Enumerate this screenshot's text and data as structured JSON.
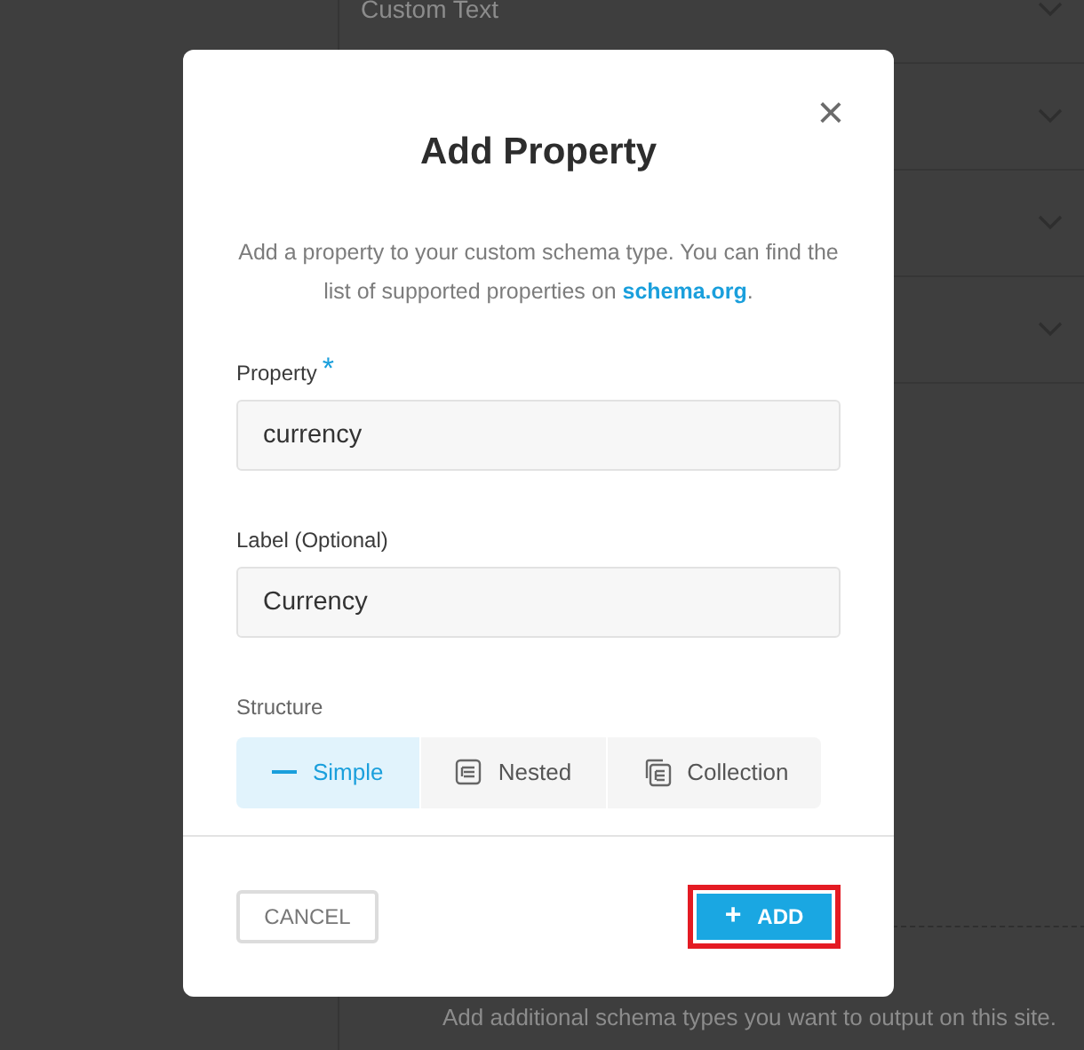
{
  "background": {
    "rows": [
      {
        "label": "Custom Text"
      },
      {
        "label": ""
      },
      {
        "label": ""
      },
      {
        "label": ""
      }
    ],
    "description": "Add additional schema types you want to output on this site."
  },
  "dialog": {
    "title": "Add Property",
    "close": "×",
    "intro_before": "Add a property to your custom schema type. You can find the list of supported properties on ",
    "intro_link": "schema.org",
    "intro_after": ".",
    "fields": [
      {
        "label": "Property",
        "required_mark": "*",
        "value": "currency"
      },
      {
        "label": "Label (Optional)",
        "value": "Currency"
      }
    ],
    "structure": {
      "label": "Structure",
      "options": [
        {
          "kind": "simple",
          "label": "Simple",
          "selected": true
        },
        {
          "kind": "nested",
          "label": "Nested",
          "selected": false
        },
        {
          "kind": "collection",
          "label": "Collection",
          "selected": false
        }
      ]
    },
    "cancel": "CANCEL",
    "add": {
      "icon": "+",
      "label": "ADD",
      "highlighted": true
    }
  }
}
